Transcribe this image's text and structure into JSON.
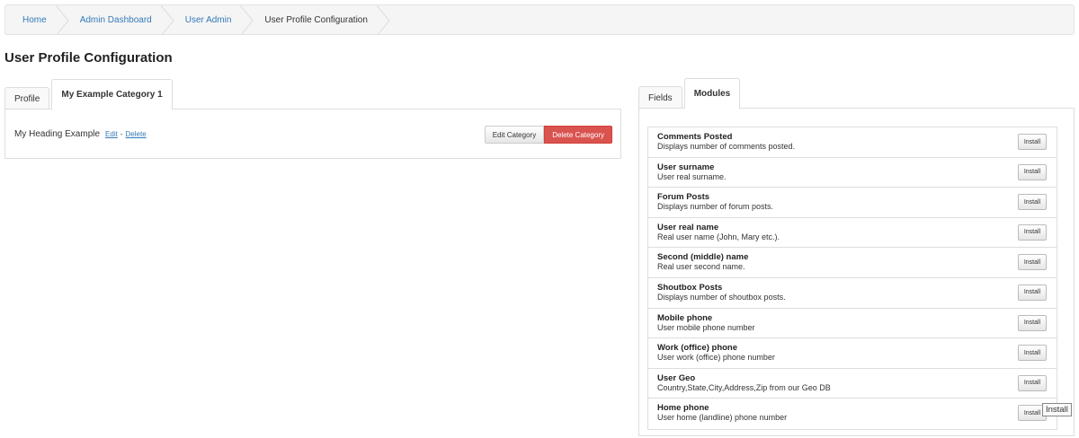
{
  "breadcrumb": {
    "items": [
      {
        "label": "Home"
      },
      {
        "label": "Admin Dashboard"
      },
      {
        "label": "User Admin"
      },
      {
        "label": "User Profile Configuration"
      }
    ]
  },
  "page_title": "User Profile Configuration",
  "left_tabs": [
    {
      "label": "Profile"
    },
    {
      "label": "My Example Category 1"
    }
  ],
  "category": {
    "heading": "My Heading Example",
    "edit_label": "Edit",
    "separator": "-",
    "delete_label": "Delete",
    "edit_category_label": "Edit Category",
    "delete_category_label": "Delete Category",
    "colors": {
      "danger": "#d9534f",
      "link": "#337ab7"
    }
  },
  "right_tabs": [
    {
      "label": "Fields"
    },
    {
      "label": "Modules"
    }
  ],
  "modules": [
    {
      "title": "Comments Posted",
      "desc": "Displays number of comments posted.",
      "button": "Install"
    },
    {
      "title": "User surname",
      "desc": "User real surname.",
      "button": "Install"
    },
    {
      "title": "Forum Posts",
      "desc": "Displays number of forum posts.",
      "button": "Install"
    },
    {
      "title": "User real name",
      "desc": "Real user name (John, Mary etc.).",
      "button": "Install"
    },
    {
      "title": "Second (middle) name",
      "desc": "Real user second name.",
      "button": "Install"
    },
    {
      "title": "Shoutbox Posts",
      "desc": "Displays number of shoutbox posts.",
      "button": "Install"
    },
    {
      "title": "Mobile phone",
      "desc": "User mobile phone number",
      "button": "Install"
    },
    {
      "title": "Work (office) phone",
      "desc": "User work (office) phone number",
      "button": "Install"
    },
    {
      "title": "User Geo",
      "desc": "Country,State,City,Address,Zip from our Geo DB",
      "button": "Install"
    },
    {
      "title": "Home phone",
      "desc": "User home (landline) phone number",
      "button": "Install"
    }
  ],
  "tooltip": "Install"
}
